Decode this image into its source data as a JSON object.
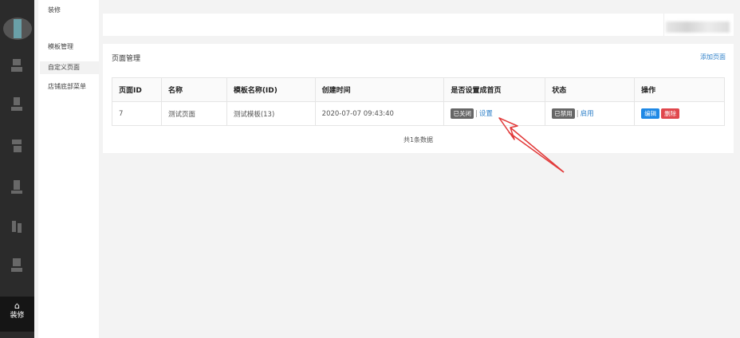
{
  "submenu": {
    "items": [
      {
        "label": "装修"
      },
      {
        "label": "模板管理"
      },
      {
        "label": "自定义页面"
      },
      {
        "label": "店铺底部菜单"
      }
    ]
  },
  "rail": {
    "active_icon": "folder-icon",
    "active_label": "装修"
  },
  "panel": {
    "title": "页面管理",
    "add_link": "添加页面"
  },
  "table": {
    "headers": [
      "页面ID",
      "名称",
      "模板名称(ID)",
      "创建时间",
      "是否设置成首页",
      "状态",
      "操作"
    ],
    "rows": [
      {
        "id": "7",
        "name": "测试页面",
        "template": "测试模板(13)",
        "created": "2020-07-07 09:43:40",
        "home_badge": "已关闭",
        "home_action": "设置",
        "status_badge": "已禁用",
        "status_action": "启用",
        "edit": "编辑",
        "delete": "删除"
      }
    ],
    "footer": "共1条数据"
  },
  "colors": {
    "accent": "#2f80c9",
    "danger": "#e0474c",
    "primary_button": "#1e88e5",
    "annotation_arrow": "#e23a3a"
  }
}
